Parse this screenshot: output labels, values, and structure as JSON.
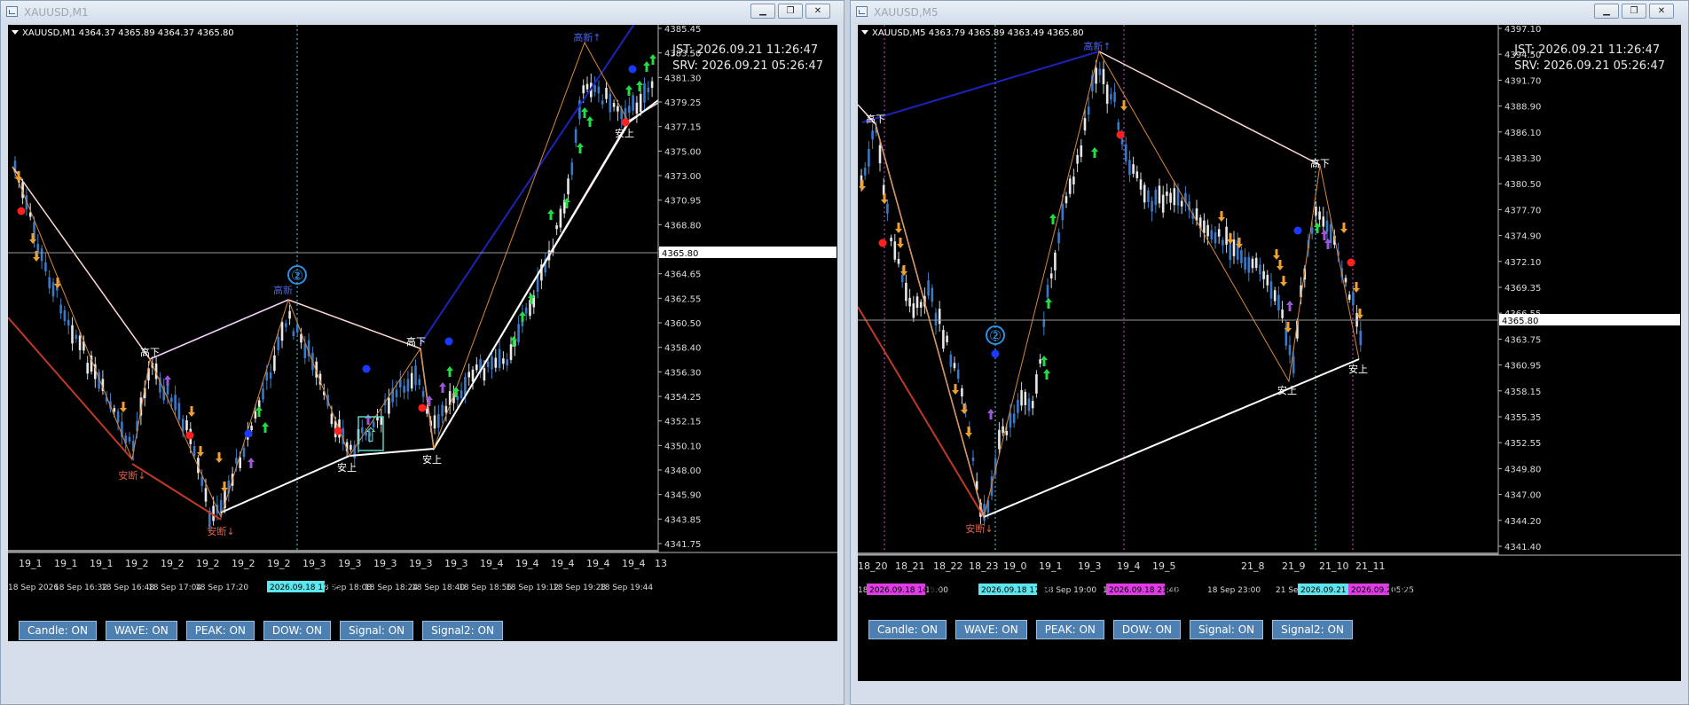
{
  "left": {
    "title": "XAUUSD,M1",
    "info": "XAUUSD,M1  4364.37 4365.89 4364.37 4365.80",
    "clock": [
      "JST: 2026.09.21 11:26:47",
      "SRV: 2026.09.21 05:26:47"
    ],
    "buttons": [
      "Candle: ON",
      "WAVE: ON",
      "PEAK: ON",
      "DOW: ON",
      "Signal: ON",
      "Signal2: ON"
    ],
    "price_ticks": [
      "4385.45",
      "4383.50",
      "4381.30",
      "4379.25",
      "4377.15",
      "4375.00",
      "4373.00",
      "4370.95",
      "4368.80",
      "4366.75",
      "4364.65",
      "4362.55",
      "4360.50",
      "4358.40",
      "4356.30",
      "4354.25",
      "4352.15",
      "4350.10",
      "4348.00",
      "4345.90",
      "4343.85",
      "4341.75"
    ],
    "current_price": "4365.80",
    "upper_labels": [
      "19_1",
      "19_1",
      "19_1",
      "19_2",
      "19_2",
      "19_2",
      "19_2",
      "19_2",
      "19_3",
      "19_3",
      "19_3",
      "19_3",
      "19_3",
      "19_4",
      "19_4",
      "19_4",
      "19_4",
      "19_4"
    ],
    "time_labels": [
      "18 Sep 2026",
      "18 Sep 16:32",
      "18 Sep 16:48",
      "18 Sep 17:04",
      "18 Sep 17:20",
      "18 Sep 18:08",
      "18 Sep 18:24",
      "18 Sep 18:40",
      "18 Sep 18:56",
      "18 Sep 19:12",
      "18 Sep 19:28",
      "18 Sep 19:44"
    ],
    "time_highlight": "2026.09.18 17:55",
    "marker_num": "②",
    "annotations": {
      "a1": "高下",
      "a2": "高新",
      "a3": "高下",
      "a4": "安断↓",
      "a5": "安上",
      "a6": "安上",
      "a7": "安上",
      "a8": "安断↓",
      "a9": "高新↑"
    },
    "colors": {
      "up": "#d9d9d9",
      "blue": "#3a78c8",
      "trend_blue": "#1e22b8",
      "trend_white": "#ffffff",
      "trend_red": "#c23a25",
      "zig_orange": "#d8893a"
    }
  },
  "right": {
    "title": "XAUUSD,M5",
    "info": "XAUUSD,M5  4363.79 4365.89 4363.49 4365.80",
    "clock": [
      "JST: 2026.09.21 11:26:47",
      "SRV: 2026.09.21 05:26:47"
    ],
    "buttons": [
      "Candle: ON",
      "WAVE: ON",
      "PEAK: ON",
      "DOW: ON",
      "Signal: ON",
      "Signal2: ON"
    ],
    "price_ticks": [
      "4397.10",
      "4394.50",
      "4391.70",
      "4388.90",
      "4386.10",
      "4383.30",
      "4380.50",
      "4377.70",
      "4374.90",
      "4372.10",
      "4369.35",
      "4366.55",
      "4363.75",
      "4360.95",
      "4358.15",
      "4355.35",
      "4352.55",
      "4349.80",
      "4347.00",
      "4344.20",
      "4341.40"
    ],
    "current_price": "4365.80",
    "upper_labels": [
      "18_20",
      "18_21",
      "18_22",
      "18_23",
      "19_0",
      "19_1",
      "19_3",
      "19_4",
      "19_5",
      "21_8",
      "21_9",
      "21_10",
      "21_11"
    ],
    "time_labels": [
      "18",
      "15:00",
      "18 Sep 19:00",
      "18 Se",
      "1:40",
      "18 Sep 23:00",
      "21 Sep 01:25",
      "21 Se",
      "05:25"
    ],
    "time_magenta_1": "2026.09.18 14:50",
    "time_cyan": "2026.09.18 17:55",
    "time_magenta_2": "2026.09.18 21:15",
    "time_cyan_2": "2026.09.21 04:05",
    "time_magenta_3": "2026.09.21 05:10",
    "marker_num": "②",
    "annotations": {
      "b1": "高下",
      "b2": "高新↑",
      "b3": "高下",
      "b4": "安断↓",
      "b5": "安上",
      "b6": "安上"
    }
  }
}
